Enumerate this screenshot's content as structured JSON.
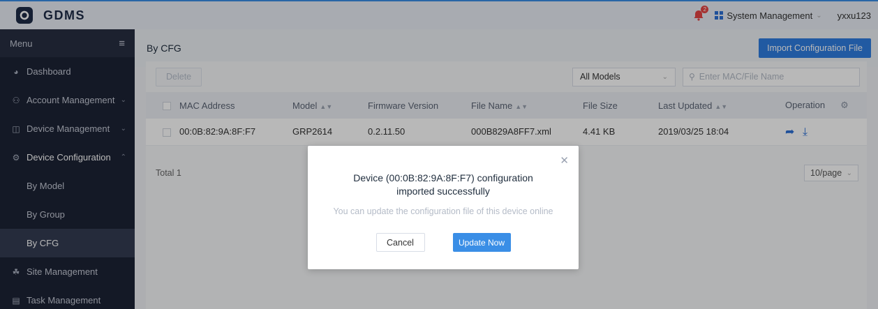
{
  "app": {
    "logo_text": "GDMS",
    "notification_count": "2",
    "system_menu_label": "System Management",
    "username": "yxxu123"
  },
  "sidebar": {
    "menu_label": "Menu",
    "items": [
      {
        "label": "Dashboard",
        "icon": "dashboard-icon"
      },
      {
        "label": "Account Management",
        "icon": "user-icon"
      },
      {
        "label": "Device Management",
        "icon": "device-icon"
      },
      {
        "label": "Device Configuration",
        "icon": "gear-icon"
      },
      {
        "label": "Site Management",
        "icon": "site-icon"
      },
      {
        "label": "Task Management",
        "icon": "task-icon"
      }
    ],
    "sub_items": [
      {
        "label": "By Model"
      },
      {
        "label": "By Group"
      },
      {
        "label": "By CFG",
        "active": true
      }
    ]
  },
  "page": {
    "title": "By CFG",
    "import_label": "Import Configuration File",
    "delete_label": "Delete",
    "model_filter": "All Models",
    "search_placeholder": "Enter MAC/File Name"
  },
  "table": {
    "columns": [
      "MAC Address",
      "Model",
      "Firmware Version",
      "File Name",
      "File Size",
      "Last Updated",
      "Operation"
    ],
    "rows": [
      {
        "mac": "00:0B:82:9A:8F:F7",
        "model": "GRP2614",
        "firmware": "0.2.11.50",
        "file_name": "000B829A8FF7.xml",
        "file_size": "4.41 KB",
        "last_updated": "2019/03/25 18:04"
      }
    ]
  },
  "footer": {
    "total": "Total 1",
    "page_size": "10/page"
  },
  "modal": {
    "title": "Device (00:0B:82:9A:8F:F7) configuration imported successfully",
    "subtitle": "You can update the configuration file of this device online",
    "cancel_label": "Cancel",
    "update_label": "Update Now"
  },
  "colors": {
    "primary": "#2f7de1",
    "sidebar_bg": "#1d2335",
    "badge": "#e54545"
  }
}
